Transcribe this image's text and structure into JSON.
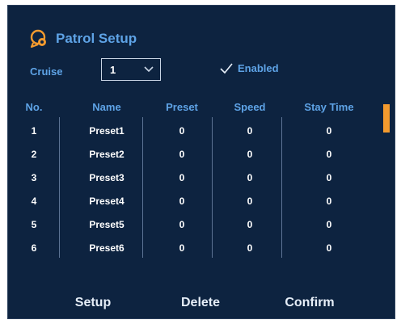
{
  "header": {
    "title": "Patrol Setup"
  },
  "cruise": {
    "label": "Cruise",
    "selected": "1"
  },
  "enabled": {
    "label": "Enabled",
    "checked": true
  },
  "table": {
    "columns": [
      "No.",
      "Name",
      "Preset",
      "Speed",
      "Stay Time"
    ],
    "rows": [
      {
        "no": "1",
        "name": "Preset1",
        "preset": "0",
        "speed": "0",
        "stay": "0"
      },
      {
        "no": "2",
        "name": "Preset2",
        "preset": "0",
        "speed": "0",
        "stay": "0"
      },
      {
        "no": "3",
        "name": "Preset3",
        "preset": "0",
        "speed": "0",
        "stay": "0"
      },
      {
        "no": "4",
        "name": "Preset4",
        "preset": "0",
        "speed": "0",
        "stay": "0"
      },
      {
        "no": "5",
        "name": "Preset5",
        "preset": "0",
        "speed": "0",
        "stay": "0"
      },
      {
        "no": "6",
        "name": "Preset6",
        "preset": "0",
        "speed": "0",
        "stay": "0"
      }
    ]
  },
  "buttons": {
    "setup": "Setup",
    "delete": "Delete",
    "confirm": "Confirm"
  },
  "colors": {
    "background": "#0d2340",
    "accent": "#5ea3e6",
    "scroll_thumb": "#f39a2e",
    "icon": "#f39a2e"
  },
  "icons": {
    "title": "patrol-camera-icon",
    "dropdown": "chevron-down-icon",
    "enabled": "checkmark-icon"
  }
}
